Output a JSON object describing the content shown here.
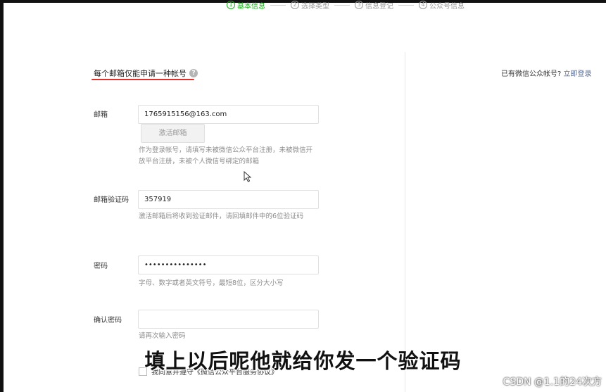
{
  "steps": [
    {
      "num": "1",
      "label": "基本信息"
    },
    {
      "num": "2",
      "label": "选择类型"
    },
    {
      "num": "3",
      "label": "信息登记"
    },
    {
      "num": "4",
      "label": "公众号信息"
    }
  ],
  "notice": {
    "text": "每个邮箱仅能申请一种帐号",
    "help_icon": "?"
  },
  "login_prompt": {
    "text": "已有微信公众帐号?",
    "link": "立即登录"
  },
  "form": {
    "email": {
      "label": "邮箱",
      "value": "1765915156@163.com",
      "activate_button": "激活邮箱",
      "hint": "作为登录帐号，请填写未被微信公众平台注册，未被微信开放平台注册，未被个人微信号绑定的邮箱"
    },
    "code": {
      "label": "邮箱验证码",
      "value": "357919",
      "hint": "激活邮箱后将收到验证邮件，请回填邮件中的6位验证码"
    },
    "password": {
      "label": "密码",
      "value": "•••••••••••••••",
      "hint": "字母、数字或者英文符号，最短8位，区分大小写"
    },
    "confirm_password": {
      "label": "确认密码",
      "value": "",
      "hint": "请再次输入密码"
    },
    "agree": {
      "label": "我同意并遵守《微信公众平台服务协议》"
    }
  },
  "subtitle": "填上以后呢他就给你发一个验证码",
  "watermark": "CSDN @1.1的24次方",
  "colors": {
    "accent_green": "#1aad19",
    "underline_red": "#e0302a",
    "link_blue": "#576b95"
  }
}
